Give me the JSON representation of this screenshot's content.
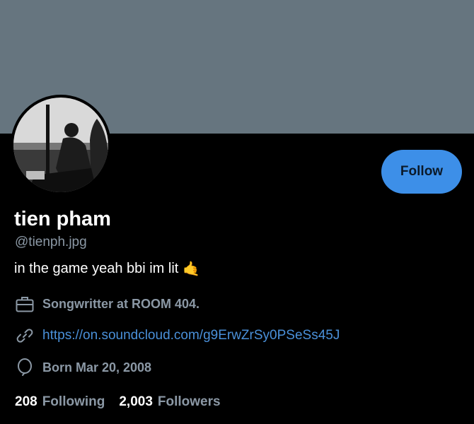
{
  "profile": {
    "name": "tien pham",
    "handle": "@tienph.jpg",
    "bio": "in the game yeah bbi im lit",
    "bio_emoji": "🤙",
    "job": "Songwritter at ROOM 404.",
    "link": "https://on.soundcloud.com/g9ErwZrSy0PSeSs45J",
    "born": "Born Mar 20, 2008"
  },
  "actions": {
    "follow_label": "Follow"
  },
  "stats": {
    "following_count": "208",
    "following_label": "Following",
    "followers_count": "2,003",
    "followers_label": "Followers"
  },
  "icons": {
    "job": "briefcase-icon",
    "link": "link-icon",
    "born": "balloon-icon"
  },
  "colors": {
    "banner": "#66757f",
    "background": "#000000",
    "accent": "#3d8fe8",
    "secondary_text": "#8b98a5",
    "link": "#4a90d9"
  }
}
